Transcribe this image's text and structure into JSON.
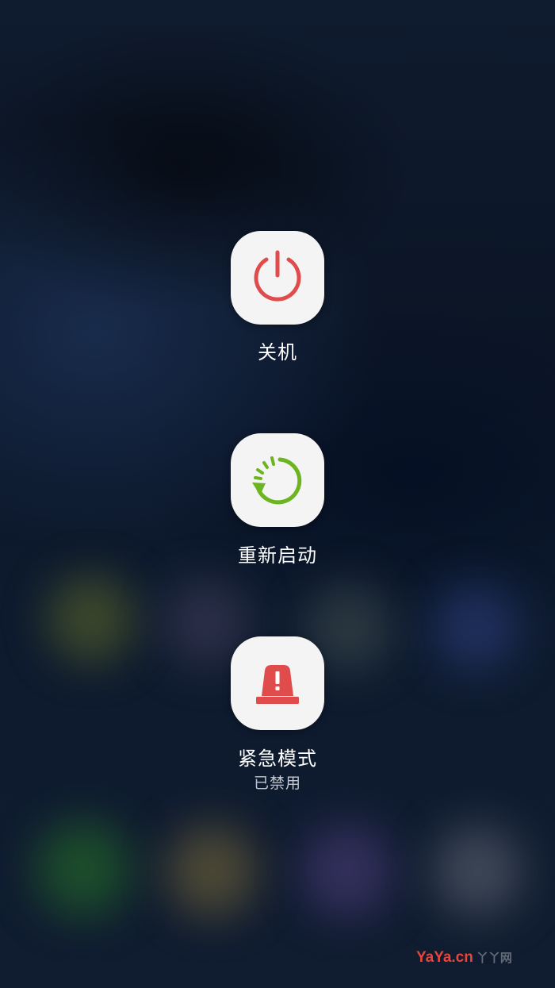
{
  "power_menu": {
    "power_off": {
      "label": "关机",
      "icon": "power-icon",
      "color": "#e04c4c"
    },
    "restart": {
      "label": "重新启动",
      "icon": "restart-icon",
      "color": "#6cb520"
    },
    "emergency": {
      "label": "紧急模式",
      "status": "已禁用",
      "icon": "siren-icon",
      "color": "#e04c4c"
    }
  },
  "watermark": {
    "brand": "YaYa.cn",
    "suffix": "丫丫网"
  },
  "colors": {
    "tile_background": "#f4f4f4",
    "background": "#0c1626"
  }
}
